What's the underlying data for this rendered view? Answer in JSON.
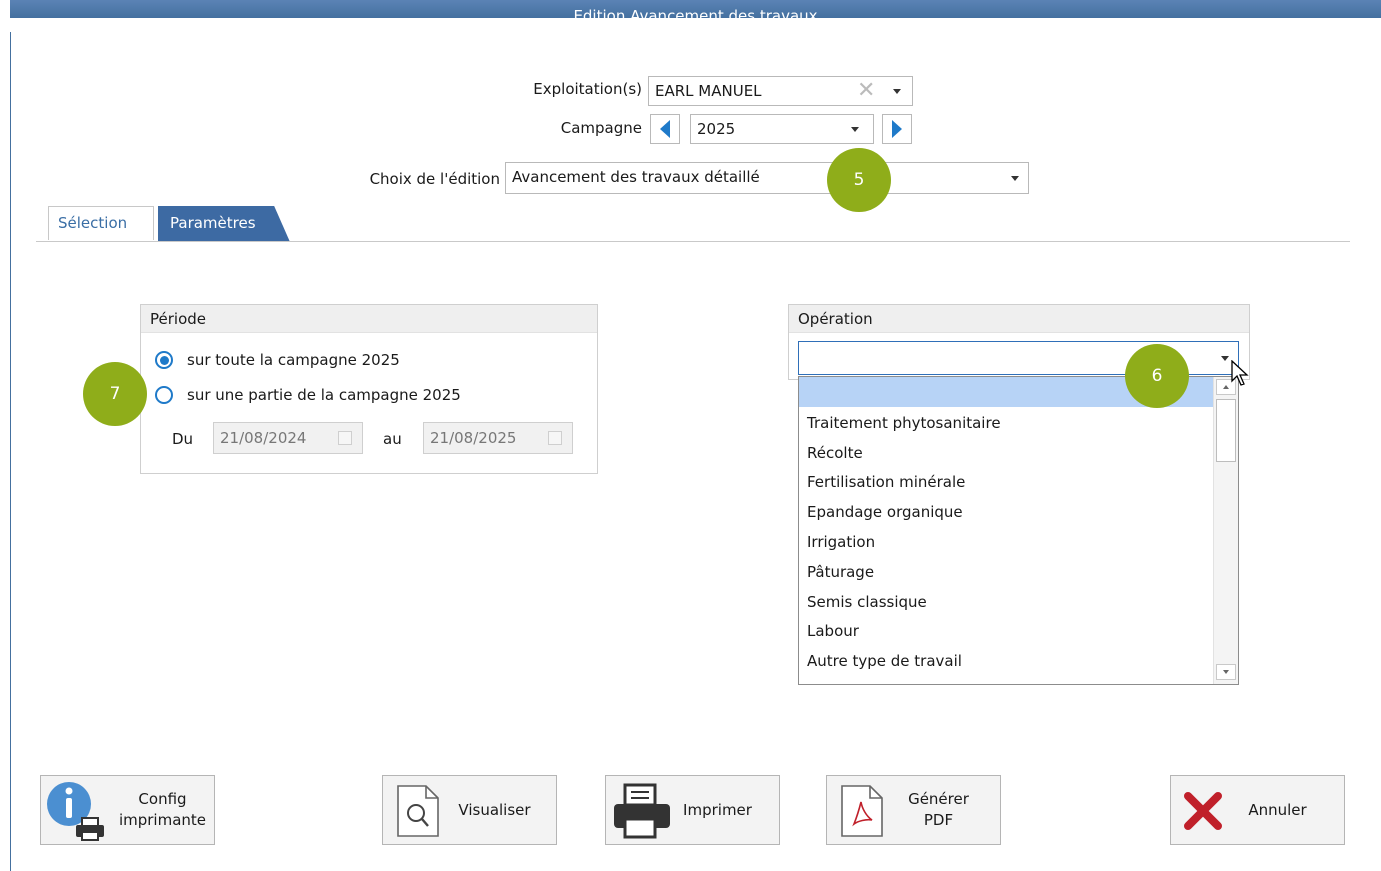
{
  "window": {
    "title": "Edition Avancement des travaux"
  },
  "header": {
    "exploitation_label": "Exploitation(s)",
    "exploitation_value": "EARL MANUEL",
    "campagne_label": "Campagne",
    "campagne_value": "2025",
    "edition_label": "Choix de l'édition",
    "edition_value": "Avancement des travaux détaillé"
  },
  "callouts": {
    "five": "5",
    "six": "6",
    "seven": "7"
  },
  "tabs": [
    {
      "label": "Sélection",
      "active": false
    },
    {
      "label": "Paramètres",
      "active": true
    }
  ],
  "periode": {
    "title": "Période",
    "option_all": "sur toute la campagne 2025",
    "option_part": "sur une partie de la campagne 2025",
    "selected": "option_all",
    "du_label": "Du",
    "du_value": "21/08/2024",
    "au_label": "au",
    "au_value": "21/08/2025"
  },
  "operation": {
    "title": "Opération",
    "value": "",
    "options": [
      "",
      "Traitement phytosanitaire",
      "Récolte",
      "Fertilisation minérale",
      "Epandage organique",
      "Irrigation",
      "Pâturage",
      "Semis classique",
      "Labour",
      "Autre type de travail"
    ]
  },
  "footer": {
    "config_label_1": "Config",
    "config_label_2": "imprimante",
    "visualiser": "Visualiser",
    "imprimer": "Imprimer",
    "pdf_label_1": "Générer",
    "pdf_label_2": "PDF",
    "annuler": "Annuler"
  },
  "colors": {
    "accent": "#1f7ac9",
    "titlebar": "#44709f",
    "callout": "#8fad1a",
    "cancel": "#c0202a"
  }
}
